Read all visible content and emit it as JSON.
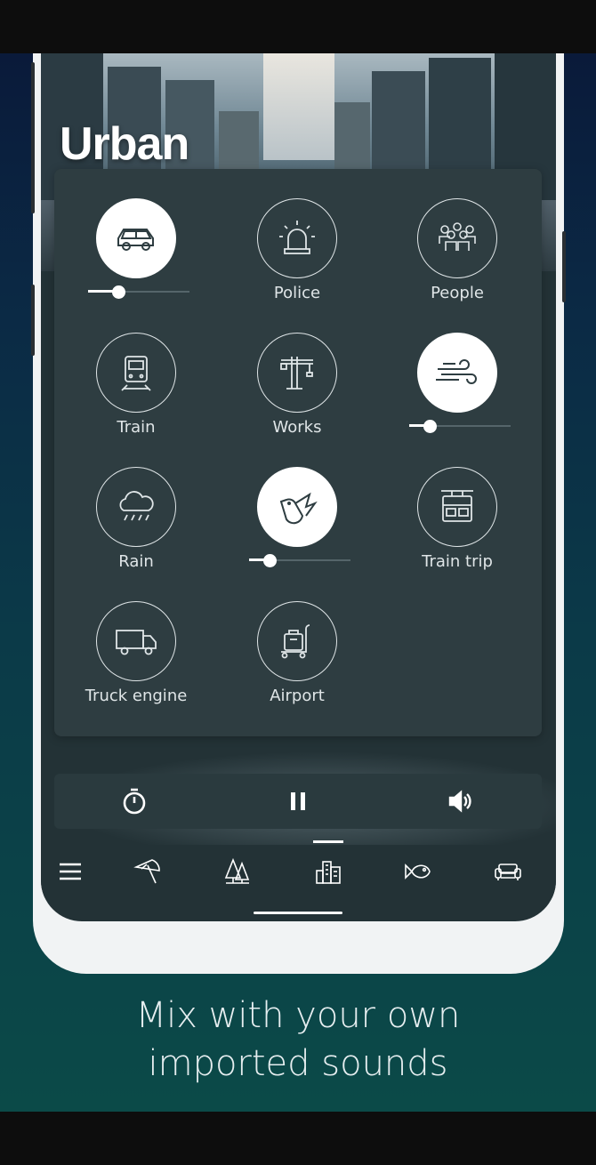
{
  "category_title": "Urban",
  "sounds": [
    {
      "icon": "car-icon",
      "label": "",
      "active": true,
      "volume": 0.3
    },
    {
      "icon": "police-siren-icon",
      "label": "Police",
      "active": false
    },
    {
      "icon": "people-crowd-icon",
      "label": "People",
      "active": false
    },
    {
      "icon": "train-icon",
      "label": "Train",
      "active": false
    },
    {
      "icon": "construction-crane-icon",
      "label": "Works",
      "active": false
    },
    {
      "icon": "wind-icon",
      "label": "",
      "active": true,
      "volume": 0.2
    },
    {
      "icon": "rain-cloud-icon",
      "label": "Rain",
      "active": false
    },
    {
      "icon": "bird-icon",
      "label": "",
      "active": true,
      "volume": 0.2
    },
    {
      "icon": "cable-car-icon",
      "label": "Train trip",
      "active": false
    },
    {
      "icon": "truck-icon",
      "label": "Truck engine",
      "active": false
    },
    {
      "icon": "airport-luggage-icon",
      "label": "Airport",
      "active": false
    }
  ],
  "controls": {
    "timer_icon": "stopwatch-icon",
    "pause_icon": "pause-icon",
    "volume_icon": "speaker-icon"
  },
  "nav": [
    {
      "icon": "menu-icon",
      "selected": false
    },
    {
      "icon": "beach-umbrella-icon",
      "selected": false
    },
    {
      "icon": "forest-icon",
      "selected": false
    },
    {
      "icon": "city-icon",
      "selected": true
    },
    {
      "icon": "fish-icon",
      "selected": false
    },
    {
      "icon": "sofa-icon",
      "selected": false
    }
  ],
  "promo": {
    "line1": "Mix with your own",
    "line2": "imported sounds"
  },
  "colors": {
    "panel": "#2e3d41",
    "screen": "#233236",
    "accent": "#ffffff"
  }
}
